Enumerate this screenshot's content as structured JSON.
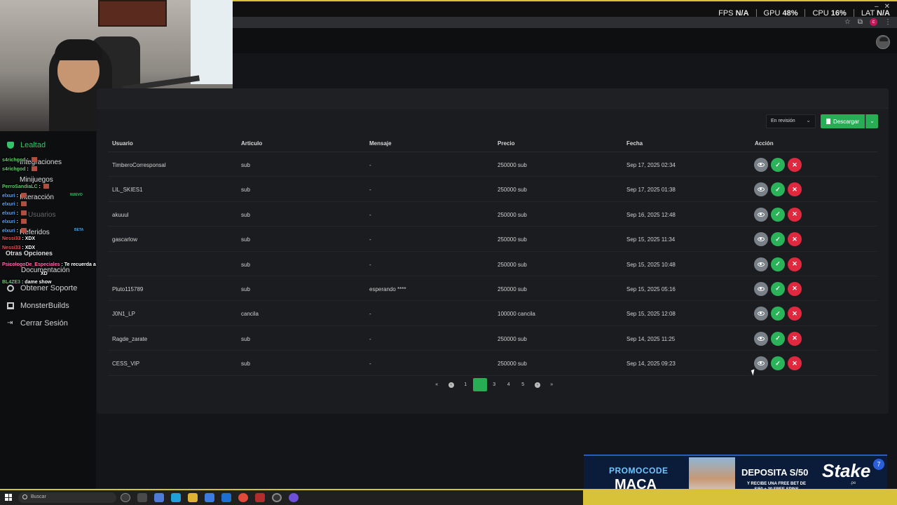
{
  "overlay": {
    "fps_label": "FPS",
    "fps_value": "N/A",
    "gpu_label": "GPU",
    "gpu_value": "48",
    "cpu_label": "CPU",
    "cpu_value": "16",
    "lat_label": "LAT",
    "lat_value": "N/A",
    "percent": "%"
  },
  "browser": {
    "profile_initial": "c"
  },
  "sidebar": {
    "items": [
      {
        "label": "Lealtad",
        "icon": "trophy-icon",
        "active": true
      },
      {
        "label": "Integraciones"
      },
      {
        "label": "Minijuegos"
      },
      {
        "label": "Interacción"
      },
      {
        "label": "Usuarios",
        "muted": true
      },
      {
        "label": "Referidos"
      }
    ],
    "section_label": "Otras Opciones",
    "bottom_items": [
      {
        "label": "Documentación"
      },
      {
        "label": "Obtener Soporte",
        "icon": "headset-icon"
      },
      {
        "label": "MonsterBuilds",
        "icon": "laptop-icon"
      },
      {
        "label": "Cerrar Sesión",
        "icon": "logout-icon"
      }
    ],
    "badge_new": "NUEVO",
    "badge_beta": "BETA"
  },
  "chat": [
    {
      "user": "s4richgod",
      "text": ""
    },
    {
      "user": "s4richgod",
      "text": ""
    },
    {
      "user": "PerroSandiaLC",
      "text": ""
    },
    {
      "user": "elxuri",
      "text": ""
    },
    {
      "user": "elxuri",
      "text": ""
    },
    {
      "user": "elxuri",
      "text": ""
    },
    {
      "user": "elxuri",
      "text": ""
    },
    {
      "user": "elxuri",
      "text": ""
    },
    {
      "user": "Nessi33",
      "text": "XDX"
    },
    {
      "user": "Nessi33",
      "text": "XDX"
    },
    {
      "user": "PsicologoDe_Especiales",
      "text": "Te recuerda a la chala del zambo que te comiste"
    },
    {
      "user": "",
      "text": "XD"
    },
    {
      "user": "BL4ZE3",
      "text": "dame show"
    }
  ],
  "filter": {
    "status_selected": "En revisión",
    "download_label": "Descargar"
  },
  "table": {
    "headers": [
      "Usuario",
      "Articulo",
      "Mensaje",
      "Precio",
      "Fecha",
      "Acción"
    ],
    "rows": [
      {
        "usuario": "TimberoCorresponsal",
        "articulo": "sub",
        "mensaje": "-",
        "precio": "250000 sub",
        "fecha": "Sep 17, 2025 02:34"
      },
      {
        "usuario": "LIL_SKIES1",
        "articulo": "sub",
        "mensaje": "-",
        "precio": "250000 sub",
        "fecha": "Sep 17, 2025 01:38"
      },
      {
        "usuario": "akuuul",
        "articulo": "sub",
        "mensaje": "-",
        "precio": "250000 sub",
        "fecha": "Sep 16, 2025 12:48"
      },
      {
        "usuario": "gascarlow",
        "articulo": "sub",
        "mensaje": "-",
        "precio": "250000 sub",
        "fecha": "Sep 15, 2025 11:34"
      },
      {
        "usuario": "",
        "articulo": "sub",
        "mensaje": "-",
        "precio": "250000 sub",
        "fecha": "Sep 15, 2025 10:48"
      },
      {
        "usuario": "Pluto115789",
        "articulo": "sub",
        "mensaje": "esperando ****",
        "precio": "250000 sub",
        "fecha": "Sep 15, 2025 05:16"
      },
      {
        "usuario": "J0N1_LP",
        "articulo": "cancila",
        "mensaje": "-",
        "precio": "100000 cancila",
        "fecha": "Sep 15, 2025 12:08"
      },
      {
        "usuario": "Ragde_zarate",
        "articulo": "sub",
        "mensaje": "-",
        "precio": "250000 sub",
        "fecha": "Sep 14, 2025 11:25"
      },
      {
        "usuario": "CESS_VIP",
        "articulo": "sub",
        "mensaje": "-",
        "precio": "250000 sub",
        "fecha": "Sep 14, 2025 09:23"
      }
    ]
  },
  "pagination": {
    "pages": [
      "1",
      "2",
      "3",
      "4",
      "5"
    ],
    "current": "2",
    "first": "«",
    "prev": "‹",
    "next": "›",
    "last": "»"
  },
  "ad": {
    "promo_label": "PROMOCODE",
    "promo_code": "MACA",
    "deposit": "DEPOSITA S/50",
    "deposit_sub_1": "Y RECIBE UNA FREE BET DE",
    "deposit_sub_2": "S/50 + 30 FREE SPINS",
    "brand": "Stake",
    "brand_tld": ".pe"
  },
  "taskbar": {
    "search_placeholder": "Buscar"
  },
  "colors": {
    "accent_green": "#27ae55",
    "danger_red": "#e0283e",
    "view_grey": "#7a8088",
    "active_green": "#35c26a"
  }
}
